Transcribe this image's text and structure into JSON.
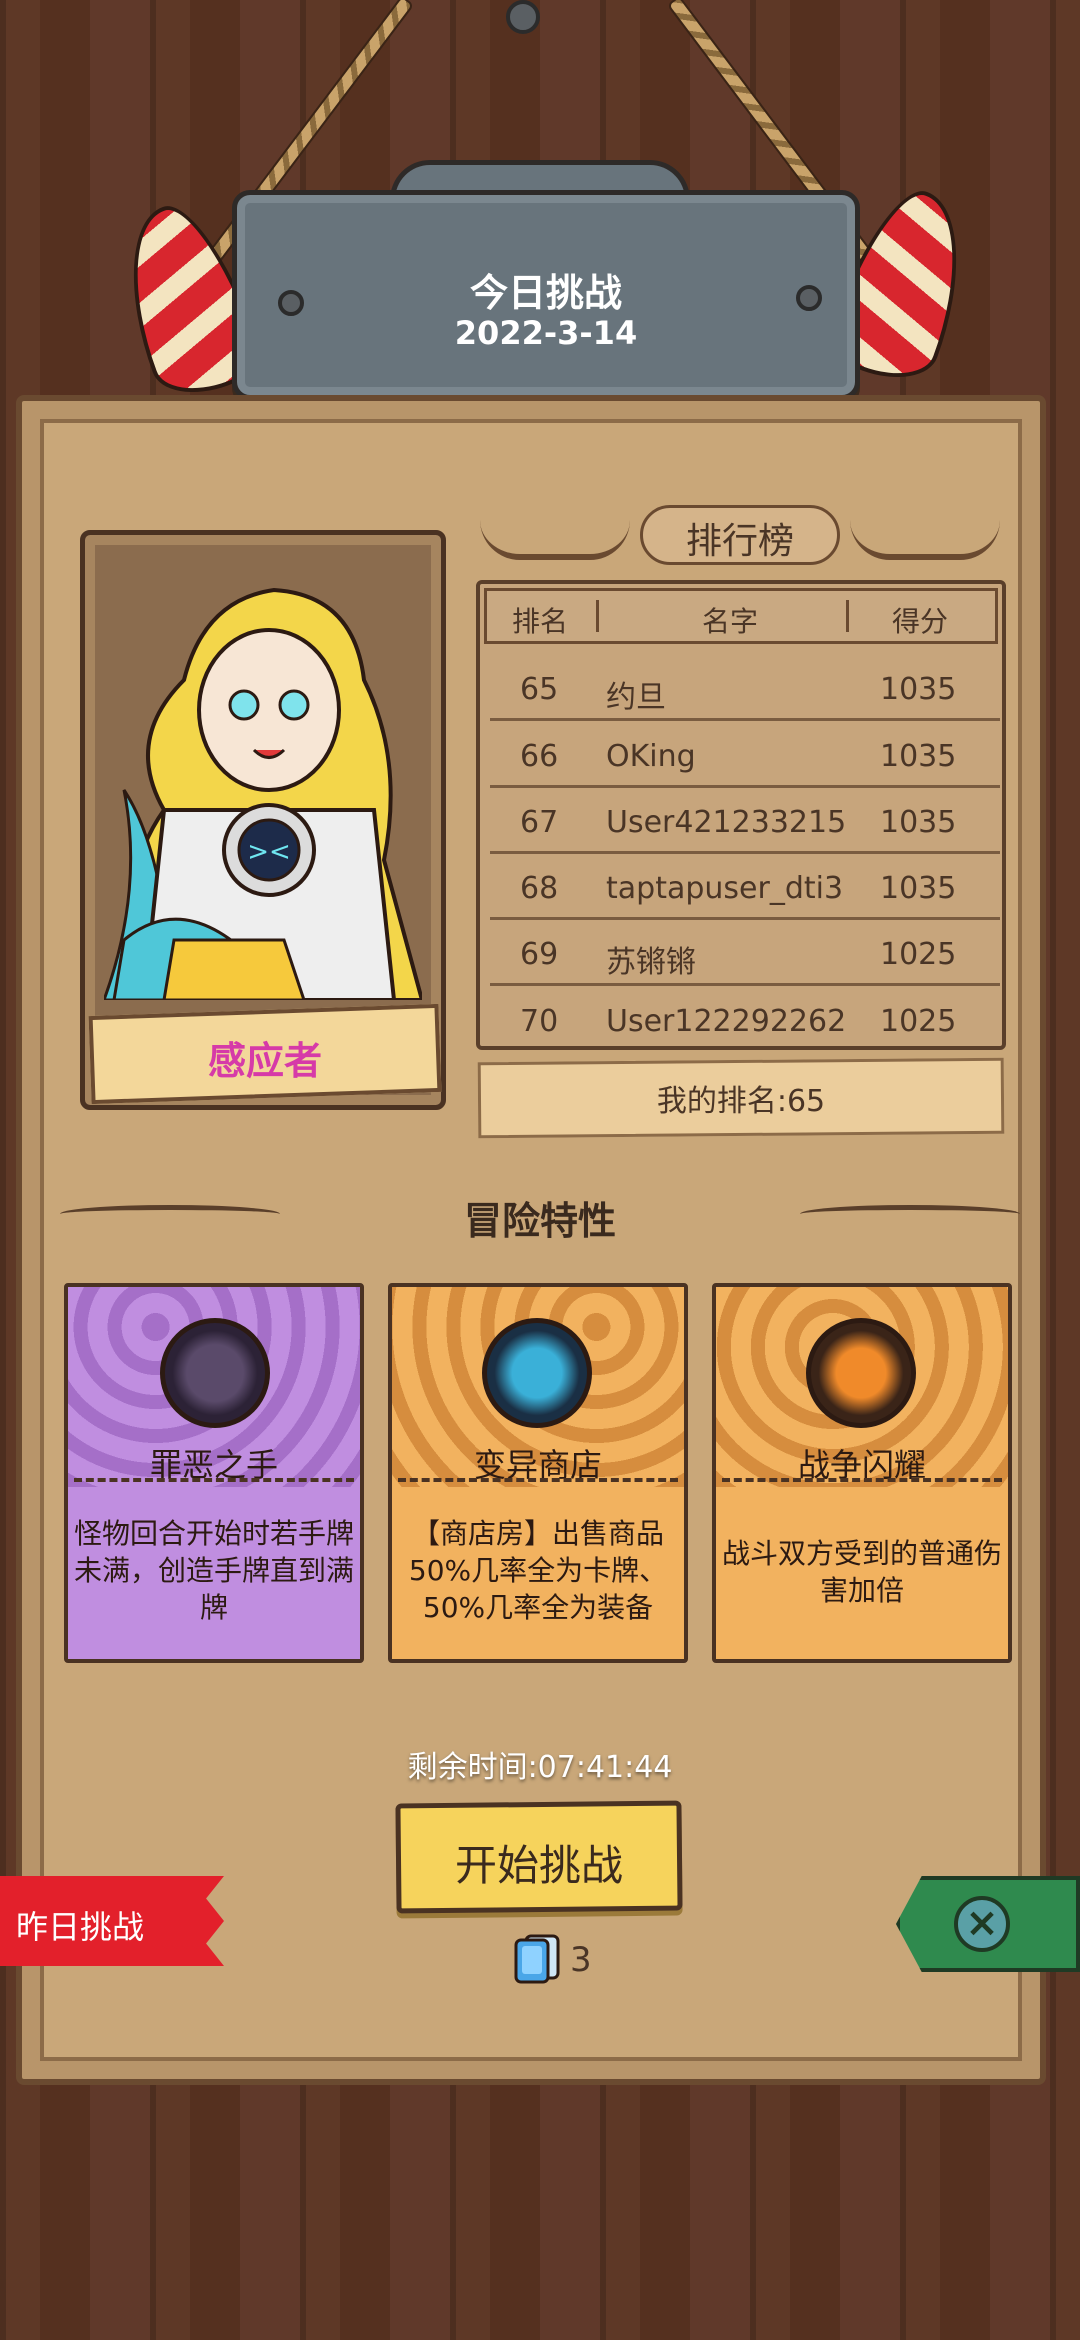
{
  "header": {
    "title": "今日挑战",
    "date": "2022-3-14"
  },
  "character": {
    "name": "感应者"
  },
  "leaderboard": {
    "title": "排行榜",
    "columns": [
      "排名",
      "名字",
      "得分"
    ],
    "rows": [
      {
        "rank": "65",
        "name": "约旦",
        "score": "1035"
      },
      {
        "rank": "66",
        "name": "OKing",
        "score": "1035"
      },
      {
        "rank": "67",
        "name": "User421233215",
        "score": "1035"
      },
      {
        "rank": "68",
        "name": "taptapuser_dti3",
        "score": "1035"
      },
      {
        "rank": "69",
        "name": "苏锵锵",
        "score": "1025"
      },
      {
        "rank": "70",
        "name": "User122292262",
        "score": "1025"
      }
    ],
    "my_rank": "我的排名:65"
  },
  "traits": {
    "title": "冒险特性",
    "items": [
      {
        "name": "罪恶之手",
        "desc": "怪物回合开始时若手牌未满，创造手牌直到满牌",
        "color": "#c08ee0",
        "icon": "skull-hand-icon"
      },
      {
        "name": "变异商店",
        "desc": "【商店房】出售商品50%几率全为卡牌、50%几率全为装备",
        "color": "#f2b25f",
        "icon": "mutant-shop-icon"
      },
      {
        "name": "战争闪耀",
        "desc": "战斗双方受到的普通伤害加倍",
        "color": "#f2b25f",
        "icon": "war-flag-icon"
      }
    ]
  },
  "footer": {
    "timer": "剩余时间:07:41:44",
    "start_label": "开始挑战",
    "ticket_count": "3",
    "yesterday_label": "昨日挑战"
  },
  "colors": {
    "accent_red": "#e3202b",
    "button_yellow": "#f6d35c",
    "tab_green": "#2f8a4e",
    "character_name": "#d63aa8"
  }
}
